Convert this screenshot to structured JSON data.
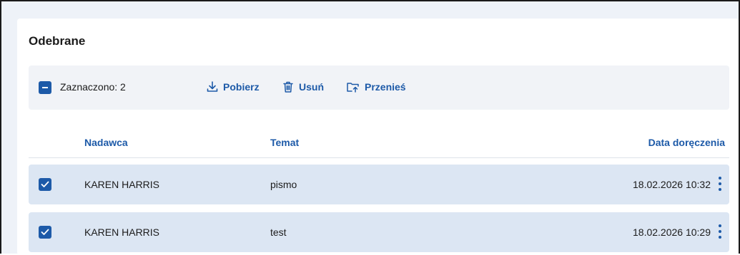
{
  "panel": {
    "title": "Odebrane"
  },
  "toolbar": {
    "selected_label": "Zaznaczono: 2",
    "actions": [
      {
        "label": "Pobierz",
        "icon": "download-icon"
      },
      {
        "label": "Usuń",
        "icon": "trash-icon"
      },
      {
        "label": "Przenieś",
        "icon": "move-folder-icon"
      }
    ]
  },
  "table": {
    "columns": [
      "Nadawca",
      "Temat",
      "Data doręczenia"
    ],
    "rows": [
      {
        "checked": true,
        "sender": "KAREN HARRIS",
        "subject": "pismo",
        "date": "18.02.2026 10:32"
      },
      {
        "checked": true,
        "sender": "KAREN HARRIS",
        "subject": "test",
        "date": "18.02.2026 10:29"
      }
    ]
  },
  "colors": {
    "accent": "#1d5aa8",
    "row_selected": "#dce6f3",
    "toolbar_bg": "#f1f3f7"
  }
}
